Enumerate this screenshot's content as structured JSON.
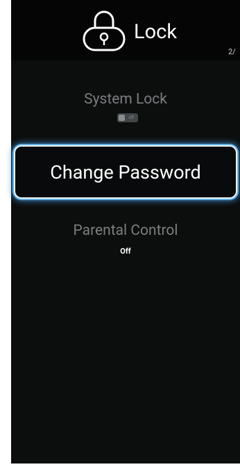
{
  "header": {
    "title": "Lock",
    "icon": "lock-icon",
    "page_indicator": "2/"
  },
  "menu": {
    "system_lock": {
      "label": "System Lock",
      "toggle_state": "off",
      "toggle_text": "off"
    },
    "change_password": {
      "label": "Change Password",
      "focused": true
    },
    "parental_control": {
      "label": "Parental Control",
      "value": "Off"
    }
  },
  "colors": {
    "background": "#0c0e0e",
    "header_background": "#050505",
    "focus_glow": "#5fb0ec",
    "dim_text": "#7b7d7f",
    "text": "#ffffff"
  }
}
